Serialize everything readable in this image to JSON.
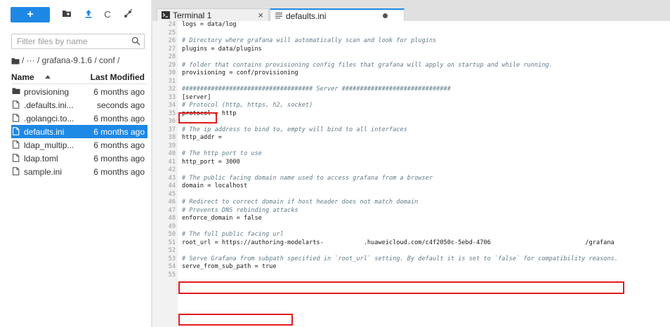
{
  "sidebar": {
    "toolbar": {
      "new_label": "+",
      "icons": [
        "new-folder-icon",
        "upload-icon",
        "refresh-icon",
        "git-icon"
      ],
      "refresh_glyph": "C"
    },
    "filter": {
      "placeholder": "Filter files by name",
      "value": ""
    },
    "breadcrumb": {
      "text": "/ ··· / grafana-9.1.6 / conf /"
    },
    "columns": {
      "name": "Name",
      "modified": "Last Modified"
    },
    "files": [
      {
        "name": "provisioning",
        "modified": "6 months ago",
        "type": "folder",
        "selected": false
      },
      {
        "name": ".defaults.ini...",
        "modified": "seconds ago",
        "type": "file",
        "selected": false
      },
      {
        "name": ".golangci.to...",
        "modified": "6 months ago",
        "type": "file",
        "selected": false
      },
      {
        "name": "defaults.ini",
        "modified": "6 months ago",
        "type": "file",
        "selected": true
      },
      {
        "name": "ldap_multip...",
        "modified": "6 months ago",
        "type": "file",
        "selected": false
      },
      {
        "name": "ldap.toml",
        "modified": "6 months ago",
        "type": "file",
        "selected": false
      },
      {
        "name": "sample.ini",
        "modified": "6 months ago",
        "type": "file",
        "selected": false
      }
    ]
  },
  "tabs": [
    {
      "label": "Terminal 1",
      "close": "×",
      "active": false
    },
    {
      "label": "defaults.ini",
      "active": true,
      "unsaved": true
    }
  ],
  "editor": {
    "lines": [
      {
        "n": "24",
        "text": "logs = data/log",
        "kind": "code"
      },
      {
        "n": "25",
        "text": "",
        "kind": "code"
      },
      {
        "n": "26",
        "text": "# Directory where grafana will automatically scan and look for plugins",
        "kind": "comment"
      },
      {
        "n": "27",
        "text": "plugins = data/plugins",
        "kind": "code"
      },
      {
        "n": "28",
        "text": "",
        "kind": "code"
      },
      {
        "n": "29",
        "text": "# folder that contains provisioning config files that grafana will apply on startup and while running.",
        "kind": "comment"
      },
      {
        "n": "30",
        "text": "provisioning = conf/provisioning",
        "kind": "code"
      },
      {
        "n": "31",
        "text": "",
        "kind": "code"
      },
      {
        "n": "32",
        "text": "#################################### Server ##############################",
        "kind": "comment"
      },
      {
        "n": "33",
        "text": "[server]",
        "kind": "code"
      },
      {
        "n": "34",
        "text": "# Protocol (http, https, h2, socket)",
        "kind": "comment"
      },
      {
        "n": "35",
        "text": "protocol = http",
        "kind": "code"
      },
      {
        "n": "36",
        "text": "",
        "kind": "code"
      },
      {
        "n": "37",
        "text": "# The ip address to bind to, empty will bind to all interfaces",
        "kind": "comment"
      },
      {
        "n": "38",
        "text": "http_addr =",
        "kind": "code"
      },
      {
        "n": "39",
        "text": "",
        "kind": "code"
      },
      {
        "n": "40",
        "text": "# The http port to use",
        "kind": "comment"
      },
      {
        "n": "41",
        "text": "http_port = 3000",
        "kind": "code"
      },
      {
        "n": "42",
        "text": "",
        "kind": "code"
      },
      {
        "n": "43",
        "text": "# The public facing domain name used to access grafana from a browser",
        "kind": "comment"
      },
      {
        "n": "44",
        "text": "domain = localhost",
        "kind": "code"
      },
      {
        "n": "45",
        "text": "",
        "kind": "code"
      },
      {
        "n": "46",
        "text": "# Redirect to correct domain if host header does not match domain",
        "kind": "comment"
      },
      {
        "n": "47",
        "text": "# Prevents DNS rebinding attacks",
        "kind": "comment"
      },
      {
        "n": "48",
        "text": "enforce_domain = false",
        "kind": "code"
      },
      {
        "n": "49",
        "text": "",
        "kind": "code"
      },
      {
        "n": "50",
        "text": "# The full public facing url",
        "kind": "comment"
      },
      {
        "n": "51",
        "text": "root_url = https://authoring-modelarts-           .huaweicloud.com/c4f2050c-5ebd-4706                          /grafana",
        "kind": "code"
      },
      {
        "n": "52",
        "text": "",
        "kind": "code"
      },
      {
        "n": "53",
        "text": "# Serve Grafana from subpath specified in `root_url` setting. By default it is set to `false` for compatibility reasons.",
        "kind": "comment"
      },
      {
        "n": "54",
        "text": "serve_from_sub_path = true",
        "kind": "code"
      },
      {
        "n": "55",
        "text": "",
        "kind": "code"
      }
    ],
    "highlight_color": "#e11d1d"
  }
}
